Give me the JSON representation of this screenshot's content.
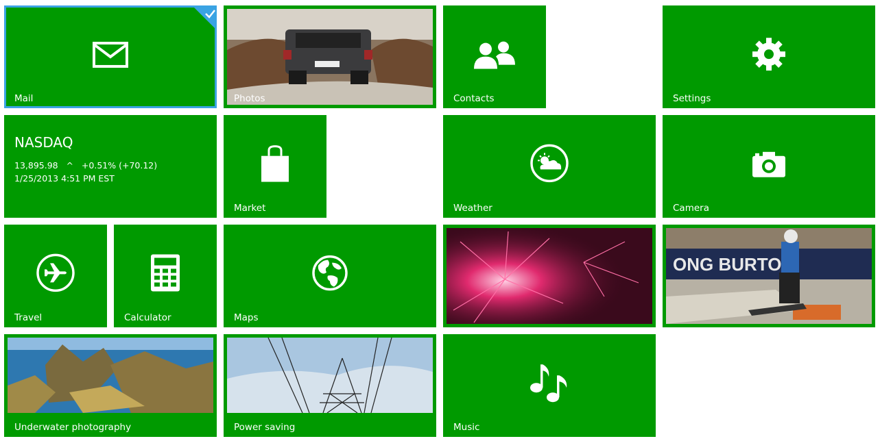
{
  "tiles": {
    "mail": {
      "label": "Mail"
    },
    "photos": {
      "label": "Photos"
    },
    "contacts": {
      "label": "Contacts"
    },
    "settings": {
      "label": "Settings"
    },
    "nasdaq": {
      "title": "NASDAQ",
      "quote": "13,895.98   ^   +0.51% (+70.12)",
      "timestamp": "1/25/2013 4:51 PM EST"
    },
    "market": {
      "label": "Market"
    },
    "weather": {
      "label": "Weather"
    },
    "camera": {
      "label": "Camera"
    },
    "travel": {
      "label": "Travel"
    },
    "calculator": {
      "label": "Calculator"
    },
    "maps": {
      "label": "Maps"
    },
    "underwater": {
      "label": "Underwater photography"
    },
    "power": {
      "label": "Power saving"
    },
    "music": {
      "label": "Music"
    }
  },
  "colors": {
    "tile": "#009a00",
    "selection": "#3aa3e3",
    "background": "#ffffff"
  },
  "icons": [
    "mail-icon",
    "contacts-icon",
    "gear-icon",
    "shopping-bag-icon",
    "weather-icon",
    "camera-icon",
    "airplane-icon",
    "calculator-icon",
    "globe-icon",
    "music-note-icon",
    "checkmark-icon"
  ]
}
